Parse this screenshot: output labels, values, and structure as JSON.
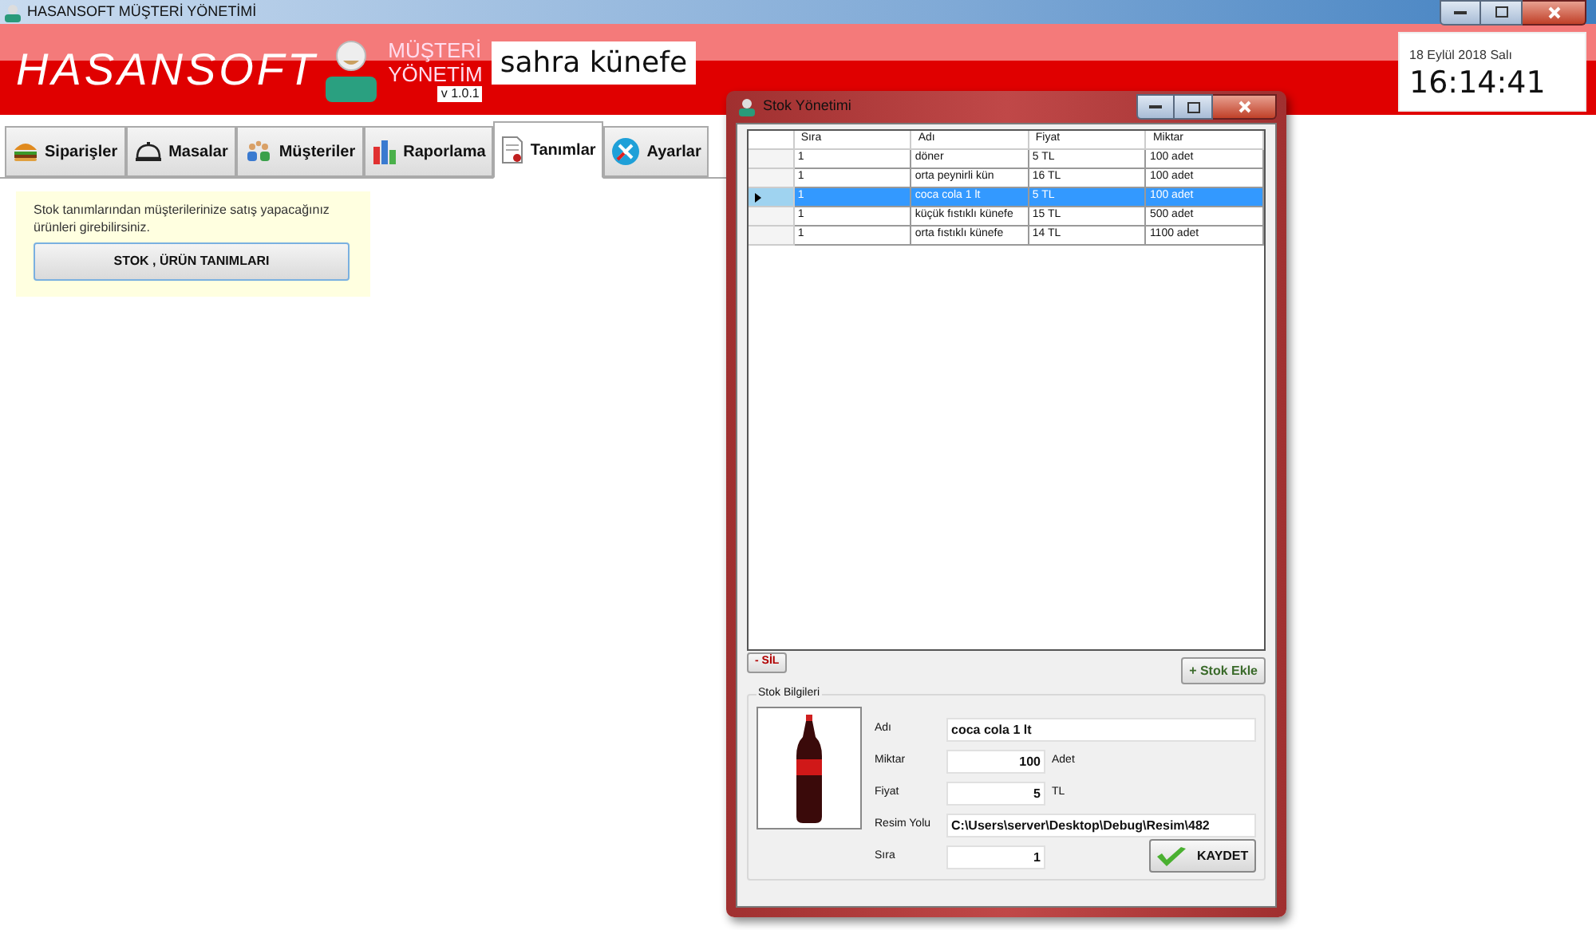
{
  "window": {
    "title": "HASANSOFT MÜŞTERİ YÖNETİMİ"
  },
  "header": {
    "brand": "HASANSOFT",
    "subtitle_line1": "MÜŞTERİ",
    "subtitle_line2": "YÖNETİM",
    "version": "v 1.0.1",
    "business_name": "sahra künefe",
    "date": "18 Eylül 2018 Salı",
    "time": "16:14:41"
  },
  "tabs": [
    {
      "label": "Siparişler",
      "kind": "burger",
      "selected": false
    },
    {
      "label": "Masalar",
      "kind": "bell",
      "selected": false
    },
    {
      "label": "Müşteriler",
      "kind": "people",
      "selected": false
    },
    {
      "label": "Raporlama",
      "kind": "chart",
      "selected": false
    },
    {
      "label": "Tanımlar",
      "kind": "document",
      "selected": true
    },
    {
      "label": "Ayarlar",
      "kind": "tools",
      "selected": false
    }
  ],
  "info_panel": {
    "text": "Stok tanımlarından müşterilerinize satış yapacağınız ürünleri girebilirsiniz.",
    "button": "STOK , ÜRÜN TANIMLARI"
  },
  "dialog": {
    "title": "Stok Yönetimi",
    "table": {
      "columns": [
        "Sıra",
        "Adı",
        "Fiyat",
        "Miktar"
      ],
      "rows": [
        {
          "cells": [
            "1",
            "döner",
            "5 TL",
            "100 adet"
          ],
          "selected": false
        },
        {
          "cells": [
            "1",
            "orta peynirli kün",
            "16 TL",
            "100 adet"
          ],
          "selected": false
        },
        {
          "cells": [
            "1",
            "coca cola 1 lt",
            "5 TL",
            "100 adet"
          ],
          "selected": true
        },
        {
          "cells": [
            "1",
            "küçük fıstıklı künefe",
            "15 TL",
            "500 adet"
          ],
          "selected": false
        },
        {
          "cells": [
            "1",
            "orta fıstıklı künefe",
            "14 TL",
            "1100 adet"
          ],
          "selected": false
        }
      ]
    },
    "delete_button": "- SİL",
    "add_button": "+ Stok Ekle",
    "group_title": "Stok Bilgileri",
    "fields": [
      {
        "label": "Adı",
        "value": "coca cola 1 lt",
        "kind": "wide"
      },
      {
        "label": "Miktar",
        "value": "100",
        "unit": "Adet",
        "kind": "number"
      },
      {
        "label": "Fiyat",
        "value": "5",
        "unit": "TL",
        "kind": "number"
      },
      {
        "label": "Resim Yolu",
        "value": "C:\\Users\\server\\Desktop\\Debug\\Resim\\482",
        "kind": "wide"
      },
      {
        "label": "Sıra",
        "value": "1",
        "kind": "number"
      }
    ],
    "save_button": "KAYDET"
  }
}
